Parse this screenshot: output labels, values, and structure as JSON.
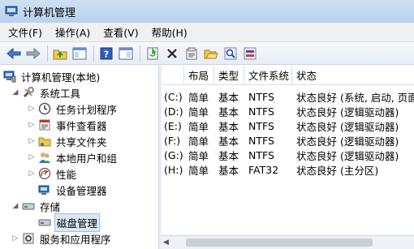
{
  "window": {
    "title": "计算机管理"
  },
  "menu": [
    "文件(F)",
    "操作(A)",
    "查看(V)",
    "帮助(H)"
  ],
  "toolbar": [
    "back-arrow-icon",
    "forward-arrow-icon",
    "up-folder-icon",
    "show-hide-tree-icon",
    "help-icon",
    "properties-pane-icon",
    "refresh-icon",
    "delete-icon",
    "properties-icon",
    "open-folder-icon",
    "search-icon",
    "disk-settings-icon"
  ],
  "tree": {
    "root": "计算机管理(本地)",
    "system_tools": "系统工具",
    "task_scheduler": "任务计划程序",
    "event_viewer": "事件查看器",
    "shared_folders": "共享文件夹",
    "local_users": "本地用户和组",
    "performance": "性能",
    "device_manager": "设备管理器",
    "storage": "存储",
    "disk_management": "磁盘管理",
    "services": "服务和应用程序"
  },
  "volumes": {
    "headers": [
      "",
      "布局",
      "类型",
      "文件系统",
      "状态"
    ],
    "rows": [
      [
        "(C:)",
        "简单",
        "基本",
        "NTFS",
        "状态良好 (系统, 启动, 页面文"
      ],
      [
        "(D:)",
        "简单",
        "基本",
        "NTFS",
        "状态良好 (逻辑驱动器)"
      ],
      [
        "(E:)",
        "简单",
        "基本",
        "NTFS",
        "状态良好 (逻辑驱动器)"
      ],
      [
        "(F:)",
        "简单",
        "基本",
        "NTFS",
        "状态良好 (逻辑驱动器)"
      ],
      [
        "(G:)",
        "简单",
        "基本",
        "NTFS",
        "状态良好 (逻辑驱动器)"
      ],
      [
        "(H:)",
        "简单",
        "基本",
        "FAT32",
        "状态良好 (主分区)"
      ]
    ]
  },
  "colors": {
    "accent": "#2a5fb0",
    "selection": "#dbe7f7"
  }
}
